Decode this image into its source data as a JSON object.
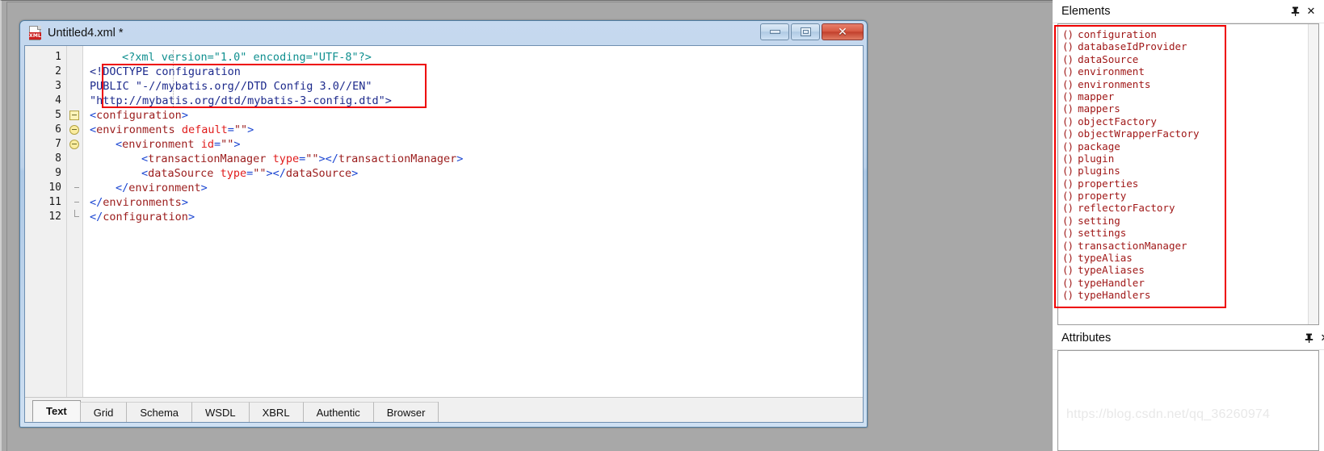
{
  "window": {
    "title": "Untitled4.xml *",
    "icon": "xml-document-icon",
    "buttons": {
      "minimize": "minimize-button",
      "maximize": "maximize-button",
      "close": "close-button"
    }
  },
  "editor": {
    "line_numbers": [
      "1",
      "2",
      "3",
      "4",
      "5",
      "6",
      "7",
      "8",
      "9",
      "10",
      "11",
      "12"
    ],
    "lines": [
      {
        "n": "1",
        "text": "<?xml version=\"1.0\" encoding=\"UTF-8\"?>"
      },
      {
        "n": "2",
        "text": "<!DOCTYPE configuration"
      },
      {
        "n": "3",
        "text": "PUBLIC \"-//mybatis.org//DTD Config 3.0//EN\""
      },
      {
        "n": "4",
        "text": "\"http://mybatis.org/dtd/mybatis-3-config.dtd\">"
      },
      {
        "n": "5",
        "text": "<configuration>"
      },
      {
        "n": "6",
        "text": "<environments default=\"\">"
      },
      {
        "n": "7",
        "text": "<environment id=\"\">"
      },
      {
        "n": "8",
        "text": "<transactionManager type=\"\"></transactionManager>"
      },
      {
        "n": "9",
        "text": "<dataSource type=\"\"></dataSource>"
      },
      {
        "n": "10",
        "text": "</environment>"
      },
      {
        "n": "11",
        "text": "</environments>"
      },
      {
        "n": "12",
        "text": "</configuration>"
      }
    ],
    "syntax": {
      "processing_instruction_color": "#0f8f8f",
      "doctype_color": "#1d2a8c",
      "bracket_color": "#1b46d2",
      "element_color": "#9b1c1c",
      "attribute_color": "#e01b1b"
    },
    "annotation_box_color": "#ee0000"
  },
  "tabs": [
    {
      "label": "Text",
      "active": true
    },
    {
      "label": "Grid",
      "active": false
    },
    {
      "label": "Schema",
      "active": false
    },
    {
      "label": "WSDL",
      "active": false
    },
    {
      "label": "XBRL",
      "active": false
    },
    {
      "label": "Authentic",
      "active": false
    },
    {
      "label": "Browser",
      "active": false
    }
  ],
  "dock": {
    "elements_panel": {
      "title": "Elements",
      "pin_icon": "pin-icon",
      "close_icon": "close-icon",
      "items": [
        "configuration",
        "databaseIdProvider",
        "dataSource",
        "environment",
        "environments",
        "mapper",
        "mappers",
        "objectFactory",
        "objectWrapperFactory",
        "package",
        "plugin",
        "plugins",
        "properties",
        "property",
        "reflectorFactory",
        "setting",
        "settings",
        "transactionManager",
        "typeAlias",
        "typeAliases",
        "typeHandler",
        "typeHandlers"
      ],
      "item_icon": "angle-brackets-icon",
      "item_icon_glyph": "()"
    },
    "attributes_panel": {
      "title": "Attributes",
      "pin_icon": "pin-icon",
      "close_icon": "close-icon",
      "items": []
    }
  },
  "watermark": {
    "text": "https://blog.csdn.net/qq_36260974"
  }
}
